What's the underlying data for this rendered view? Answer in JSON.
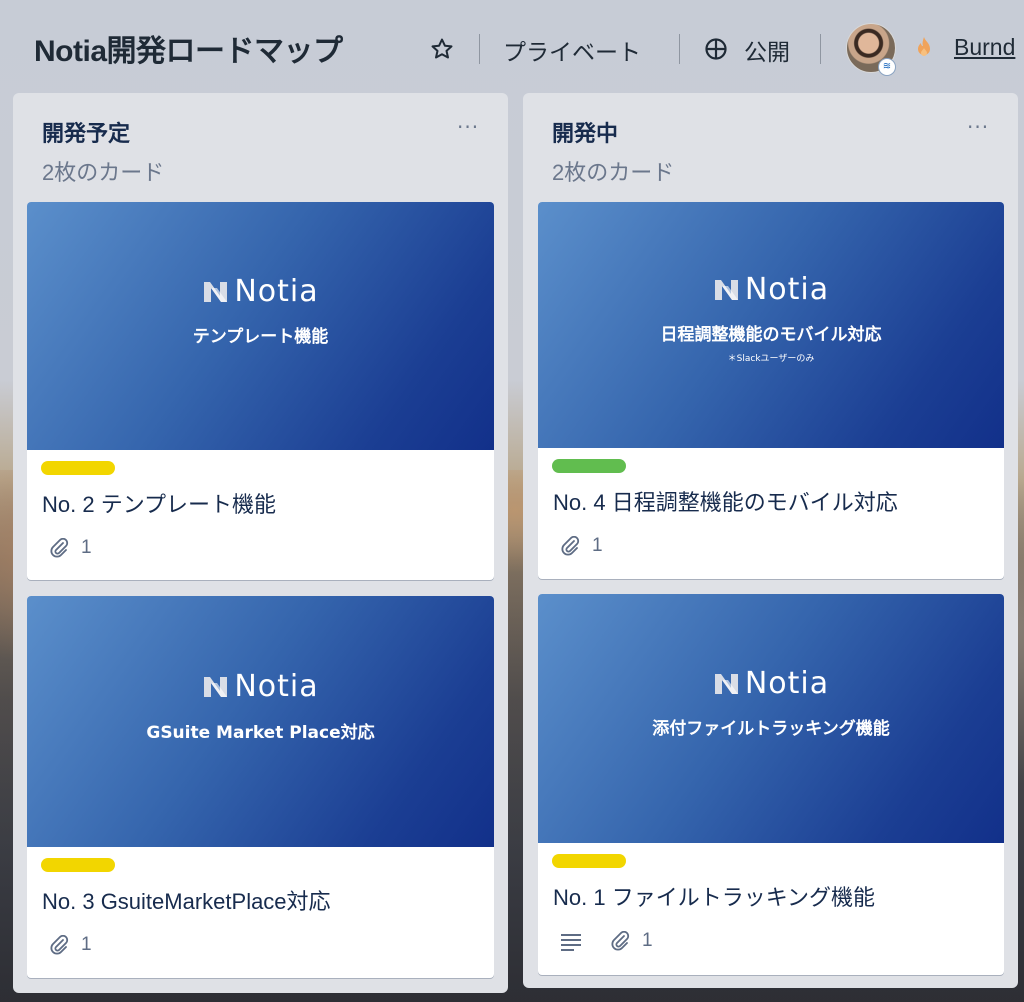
{
  "board": {
    "title": "Notia開発ロードマップ",
    "star_icon": "star-icon",
    "visibility": "プライベート",
    "team_icon": "globe-icon",
    "team": "公開",
    "avatar_icon": "avatar",
    "fire_icon": "fire-icon",
    "link": "Burnd"
  },
  "lists": [
    {
      "title": "開発予定",
      "count": "2枚のカード",
      "menu": "···",
      "cards": [
        {
          "cover_logo": "Notia",
          "cover_sub": "テンプレート機能",
          "cover_note": "",
          "label_color": "#f2d600",
          "title": "No. 2 テンプレート機能",
          "attachments": "1",
          "has_description": false
        },
        {
          "cover_logo": "Notia",
          "cover_sub": "GSuite Market Place対応",
          "cover_note": "",
          "label_color": "#f2d600",
          "title": "No. 3 GsuiteMarketPlace対応",
          "attachments": "1",
          "has_description": false
        }
      ]
    },
    {
      "title": "開発中",
      "count": "2枚のカード",
      "menu": "···",
      "cards": [
        {
          "cover_logo": "Notia",
          "cover_sub": "日程調整機能のモバイル対応",
          "cover_note": "＊Slackユーザーのみ",
          "label_color": "#61bd4f",
          "title": "No. 4 日程調整機能のモバイル対応",
          "attachments": "1",
          "has_description": false
        },
        {
          "cover_logo": "Notia",
          "cover_sub": "添付ファイルトラッキング機能",
          "cover_note": "",
          "label_color": "#f2d600",
          "title": "No. 1 ファイルトラッキング機能",
          "attachments": "1",
          "has_description": true
        }
      ]
    }
  ]
}
